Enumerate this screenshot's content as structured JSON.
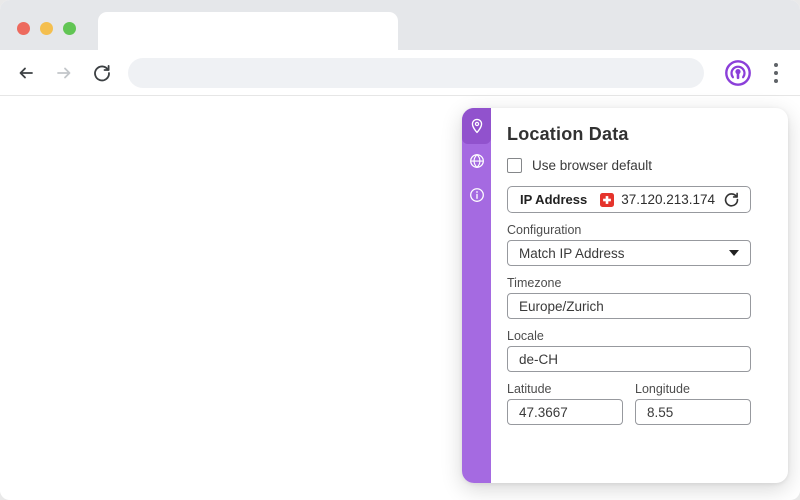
{
  "browser": {
    "tab_title": "",
    "url_value": "",
    "colors": {
      "accent_purple": "#8b3fd9",
      "titlebar_bg": "#e5e7ea",
      "urlbar_bg": "#eff1f4",
      "traffic_red": "#ed6a5e",
      "traffic_yellow": "#f4bf4f",
      "traffic_green": "#61c554"
    },
    "icons": [
      "back-arrow-icon",
      "forward-arrow-icon",
      "reload-icon",
      "location-guard-extension-icon",
      "kebab-menu-icon"
    ]
  },
  "popup": {
    "title": "Location Data",
    "use_browser_default": {
      "label": "Use browser default",
      "checked": false
    },
    "ip_row": {
      "label": "IP Address",
      "flag": "switzerland-flag-icon",
      "value": "37.120.213.174",
      "refresh_icon": "refresh-icon"
    },
    "fields": [
      {
        "label": "Configuration",
        "type": "select",
        "value": "Match IP Address"
      },
      {
        "label": "Timezone",
        "type": "text",
        "value": "Europe/Zurich"
      },
      {
        "label": "Locale",
        "type": "text",
        "value": "de-CH"
      },
      {
        "label": "Latitude",
        "type": "text",
        "value": "47.3667"
      },
      {
        "label": "Longitude",
        "type": "text",
        "value": "8.55"
      }
    ],
    "sidebar": {
      "color": "#a56ae1",
      "selected_color": "#9152cd",
      "items": [
        {
          "icon": "location-pin-icon",
          "selected": true
        },
        {
          "icon": "globe-icon",
          "selected": false
        },
        {
          "icon": "info-icon",
          "selected": false
        }
      ]
    }
  }
}
